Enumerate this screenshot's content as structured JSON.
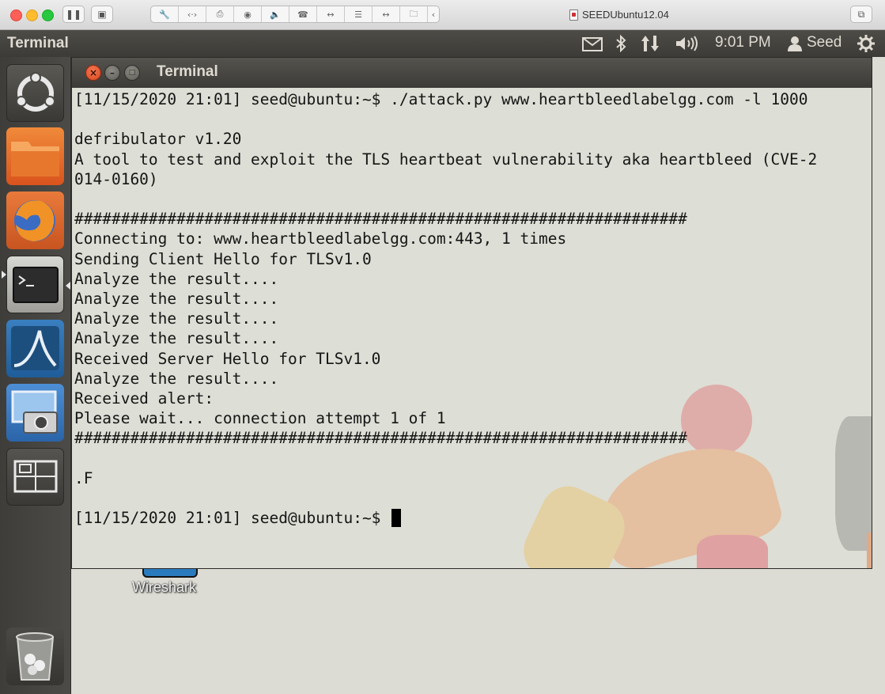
{
  "host_window": {
    "title": "SEEDUbuntu12.04",
    "toolbar_icons": [
      "wrench-icon",
      "code-icon",
      "printer-icon",
      "camera-icon",
      "speaker-icon",
      "phone-icon",
      "usb-icon",
      "disk-icon",
      "usb-icon",
      "folder-icon",
      "chevron-left-icon"
    ]
  },
  "panel": {
    "app_title": "Terminal",
    "time": "9:01 PM",
    "user": "Seed",
    "indicators": [
      "mail-icon",
      "bluetooth-icon",
      "network-icon",
      "volume-icon"
    ]
  },
  "launcher": {
    "items": [
      "ubuntu-dash",
      "files",
      "firefox",
      "terminal",
      "wireshark",
      "screenshot",
      "workspaces",
      "trash"
    ]
  },
  "desktop": {
    "wireshark_label": "Wireshark"
  },
  "terminal": {
    "title": "Terminal",
    "lines": [
      "[11/15/2020 21:01] seed@ubuntu:~$ ./attack.py www.heartbleedlabelgg.com -l 1000",
      "",
      "defribulator v1.20",
      "A tool to test and exploit the TLS heartbeat vulnerability aka heartbleed (CVE-2",
      "014-0160)",
      "",
      "##################################################################",
      "Connecting to: www.heartbleedlabelgg.com:443, 1 times",
      "Sending Client Hello for TLSv1.0",
      "Analyze the result....",
      "Analyze the result....",
      "Analyze the result....",
      "Analyze the result....",
      "Received Server Hello for TLSv1.0",
      "Analyze the result....",
      "Received alert:",
      "Please wait... connection attempt 1 of 1",
      "##################################################################",
      "",
      ".F",
      ""
    ],
    "prompt": "[11/15/2020 21:01] seed@ubuntu:~$ "
  },
  "colors": {
    "panel_bg": "#3c3b37",
    "close_button": "#e25a2f",
    "terminal_text": "#151515"
  }
}
